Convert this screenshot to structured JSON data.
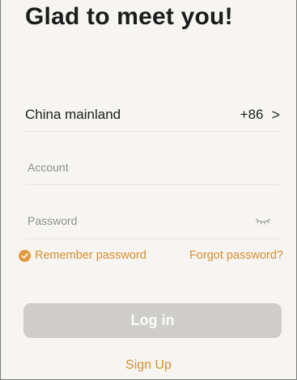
{
  "header": {
    "title": "Glad to meet you!"
  },
  "region": {
    "label": "China mainland",
    "code": "+86",
    "chevron": ">"
  },
  "account": {
    "placeholder": "Account",
    "value": ""
  },
  "password": {
    "placeholder": "Password",
    "value": "",
    "toggle_icon": "eye-closed-icon"
  },
  "options": {
    "remember_label": "Remember password",
    "remember_checked": true,
    "forgot_label": "Forgot password?"
  },
  "actions": {
    "login_label": "Log in",
    "login_enabled": false,
    "signup_label": "Sign Up"
  },
  "colors": {
    "accent": "#d98d2e",
    "button_disabled": "#cecdca",
    "background": "#f6f5f1"
  }
}
